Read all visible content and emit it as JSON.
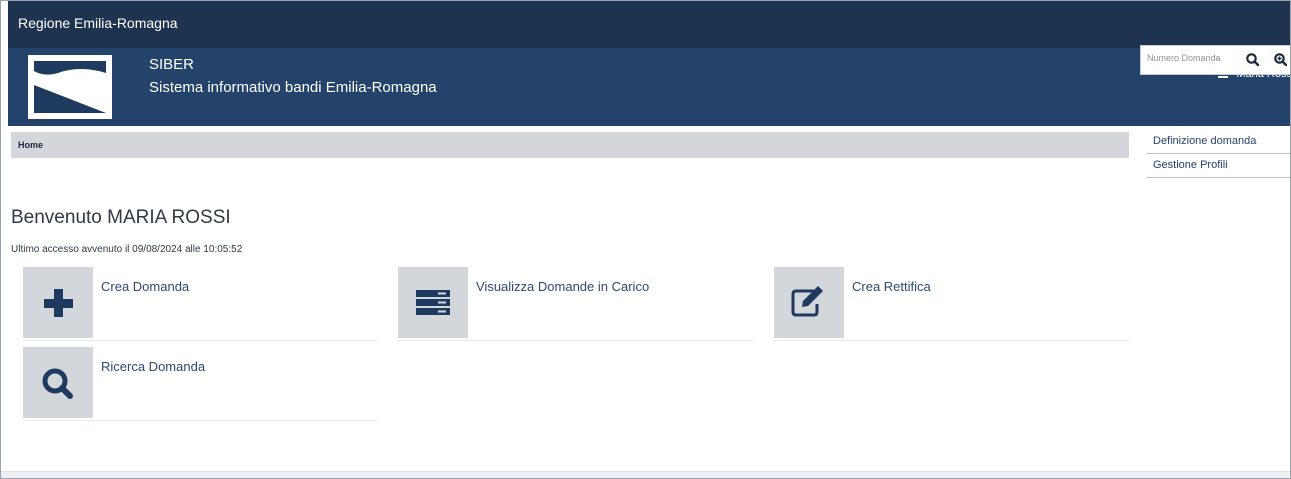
{
  "region": {
    "title": "Regione Emilia-Romagna"
  },
  "header": {
    "app_name": "SIBER",
    "app_subtitle": "Sistema informativo bandi Emilia-Romagna",
    "user_name": "Maria Ross",
    "search_placeholder": "Numero Domanda"
  },
  "breadcrumb": {
    "home": "Home"
  },
  "side_menu": {
    "items": [
      {
        "label": "Definizione domanda"
      },
      {
        "label": "Gestione Profili"
      }
    ]
  },
  "main": {
    "welcome": "Benvenuto MARIA ROSSI",
    "last_access": "Ultimo accesso avvenuto il 09/08/2024 alle 10:05:52",
    "tiles": [
      {
        "label": "Crea Domanda",
        "icon": "plus-icon"
      },
      {
        "label": "Visualizza Domande in Carico",
        "icon": "server-list-icon"
      },
      {
        "label": "Crea Rettifica",
        "icon": "edit-icon"
      },
      {
        "label": "Ricerca Domanda",
        "icon": "search-icon"
      }
    ]
  },
  "colors": {
    "region_bar": "#1d3350",
    "header": "#24436b",
    "icon_tile": "#d3d6db",
    "icon_color": "#1f3a5f"
  }
}
